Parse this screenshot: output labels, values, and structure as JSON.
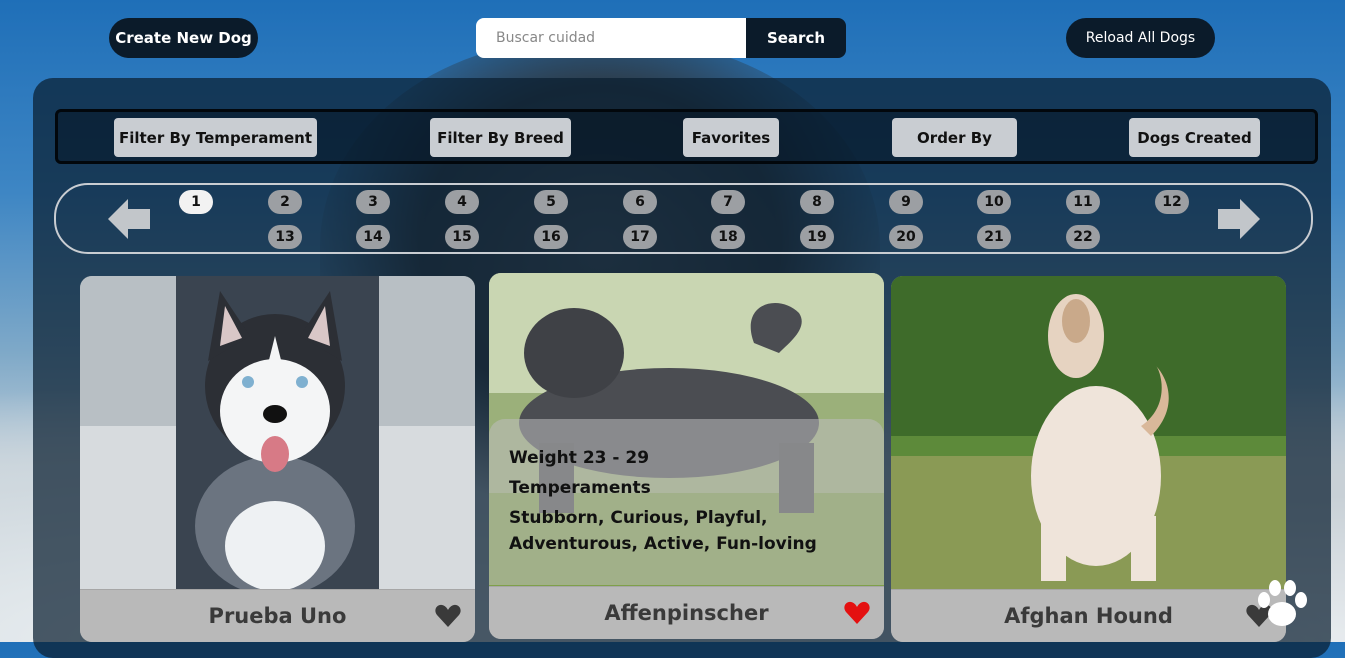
{
  "header": {
    "create_label": "Create New Dog",
    "search_placeholder": "Buscar cuidad",
    "search_label": "Search",
    "reload_label": "Reload All Dogs"
  },
  "filters": [
    {
      "label": "Filter By Temperament"
    },
    {
      "label": "Filter By Breed"
    },
    {
      "label": "Favorites"
    },
    {
      "label": "Order By"
    },
    {
      "label": "Dogs Created"
    }
  ],
  "pagination": {
    "current": 1,
    "pages": [
      "1",
      "2",
      "3",
      "4",
      "5",
      "6",
      "7",
      "8",
      "9",
      "10",
      "11",
      "12",
      "13",
      "14",
      "15",
      "16",
      "17",
      "18",
      "19",
      "20",
      "21",
      "22"
    ],
    "prev_icon": "arrow-left-icon",
    "next_icon": "arrow-right-icon"
  },
  "cards": [
    {
      "name": "Prueba Uno",
      "favorite": false
    },
    {
      "name": "Affenpinscher",
      "favorite": true,
      "weight": "Weight 23 - 29",
      "temperaments_label": "Temperaments",
      "temperaments_line1": "Stubborn, Curious, Playful,",
      "temperaments_line2": "Adventurous, Active, Fun-loving"
    },
    {
      "name": "Afghan Hound",
      "favorite": false
    }
  ],
  "colors": {
    "heart_active": "#e41010",
    "heart_inactive": "#3a3a3a",
    "button_dark": "#0b1b2a"
  }
}
